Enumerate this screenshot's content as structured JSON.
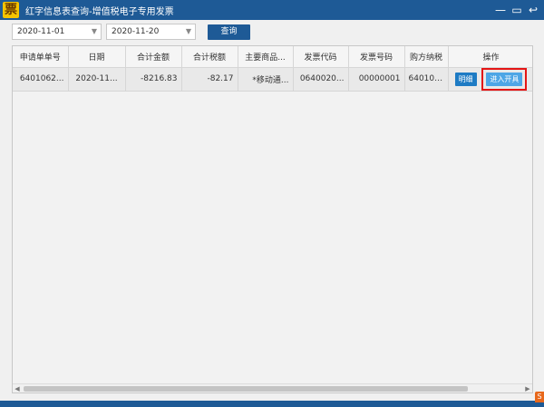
{
  "window": {
    "app_icon_glyph": "票",
    "title": "红字信息表查询-增值税电子专用发票",
    "controls": {
      "minimize_glyph": "—",
      "maximize_glyph": "▭",
      "back_glyph": "↩"
    }
  },
  "filters": {
    "start_date": "2020-11-01",
    "end_date": "2020-11-20",
    "query_label": "查询"
  },
  "table": {
    "columns": [
      "申请单单号",
      "日期",
      "合计金额",
      "合计税额",
      "主要商品...",
      "发票代码",
      "发票号码",
      "购方纳税",
      "操作"
    ],
    "rows": [
      {
        "request_no": "6401062...",
        "date": "2020-11...",
        "total_amount": "-8216.83",
        "total_tax": "-82.17",
        "main_goods": "*移动通...",
        "invoice_code": "0640020...",
        "invoice_number": "00000001",
        "buyer_tax_id": "6401064",
        "detail_label": "明细",
        "open_label": "进入开具"
      }
    ]
  },
  "scrollbar": {
    "left_arrow": "◀",
    "right_arrow": "▶"
  },
  "colors": {
    "titlebar": "#1e5a96",
    "query_button": "#1e5a96",
    "detail_button": "#1e7bc4",
    "open_button": "#4ea6e6",
    "highlight_border": "#e41515"
  }
}
